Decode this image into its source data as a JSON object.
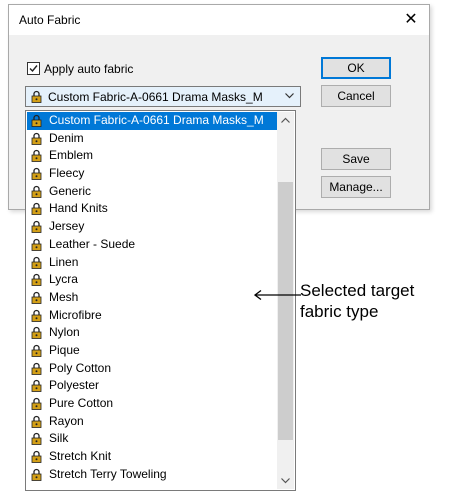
{
  "dialog": {
    "title": "Auto Fabric",
    "checkbox_label": "Apply auto fabric",
    "checkbox_checked": true,
    "combo_value": "Custom Fabric-A-0661 Drama Masks_M",
    "buttons": {
      "ok": "OK",
      "cancel": "Cancel",
      "save": "Save",
      "manage": "Manage..."
    }
  },
  "list": {
    "items": [
      "Custom Fabric-A-0661 Drama Masks_M",
      "Denim",
      "Emblem",
      "Fleecy",
      "Generic",
      "Hand Knits",
      "Jersey",
      "Leather - Suede",
      "Linen",
      "Lycra",
      "Mesh",
      "Microfibre",
      "Nylon",
      "Pique",
      "Poly Cotton",
      "Polyester",
      "Pure Cotton",
      "Rayon",
      "Silk",
      "Stretch Knit",
      "Stretch Terry Toweling"
    ],
    "selected_index": 0
  },
  "annotation": {
    "line1": "Selected target",
    "line2": "fabric type"
  },
  "colors": {
    "selection": "#0078d7",
    "lock_icon": "#d4a017"
  }
}
